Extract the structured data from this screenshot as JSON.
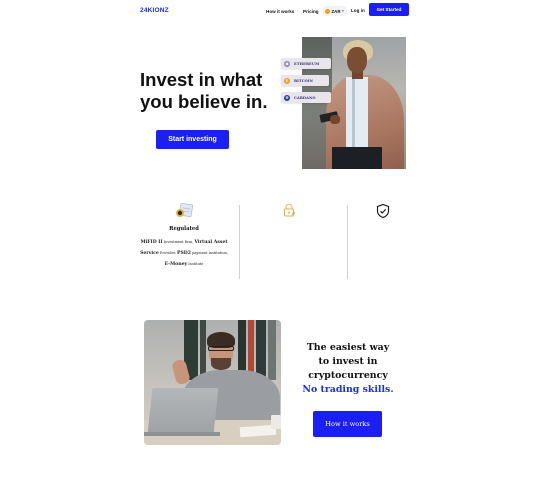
{
  "header": {
    "logo": "24KIONZ",
    "nav": {
      "how_it_works": "How it works",
      "pricing": "Pricing",
      "currency": "ZAR",
      "login": "Log in",
      "get_started": "Get Started"
    }
  },
  "hero": {
    "title_line1": "Invest in what",
    "title_line2": "you believe in.",
    "cta": "Start investing",
    "coins": [
      {
        "label": "ETHEREUM",
        "icon": "ethereum-icon",
        "color": "#8a8fb4"
      },
      {
        "label": "BITCOIN",
        "icon": "bitcoin-icon",
        "color": "#f29a1f"
      },
      {
        "label": "CARDANO",
        "icon": "cardano-icon",
        "color": "#2a3f9c"
      }
    ]
  },
  "features": {
    "regulated": {
      "title": "Regulated",
      "parts": [
        {
          "text": "MiFID II",
          "bold": true
        },
        {
          "text": " Investment firm, ",
          "bold": false
        },
        {
          "text": "Virtual Asset Service",
          "bold": true
        },
        {
          "text": " Provider, ",
          "bold": false
        },
        {
          "text": "PSD2",
          "bold": true
        },
        {
          "text": " payment institution, ",
          "bold": false
        },
        {
          "text": "E-Money",
          "bold": true
        },
        {
          "text": " Institute",
          "bold": false
        }
      ]
    }
  },
  "cta_section": {
    "line1": "The easiest way",
    "line2": "to invest in",
    "line3": "cryptocurrency",
    "highlight": "No trading skills.",
    "button": "How it works"
  },
  "colors": {
    "brand": "#1a2cff",
    "button": "#1a20f5",
    "divider": "#cfcfd4"
  }
}
